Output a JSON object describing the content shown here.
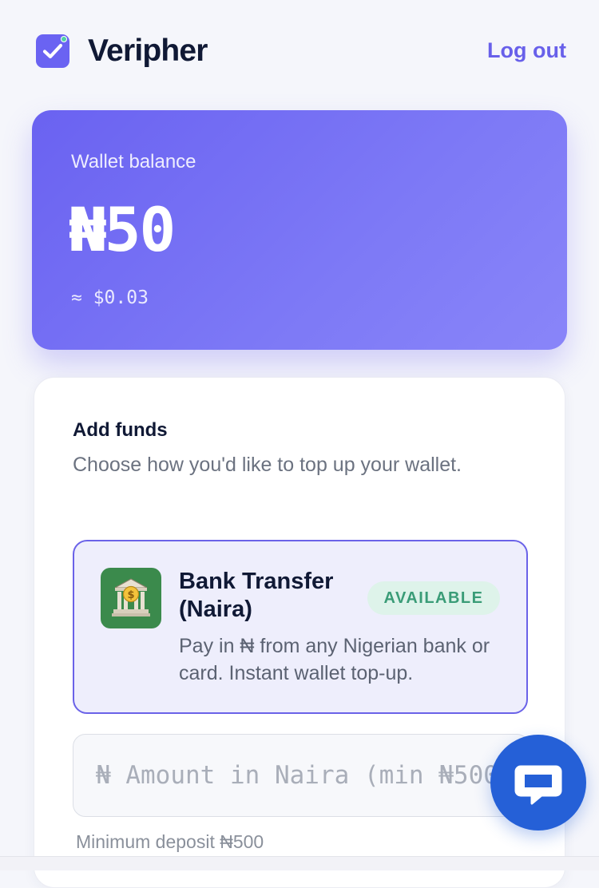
{
  "header": {
    "brand": "Veripher",
    "logout_label": "Log out"
  },
  "wallet": {
    "label": "Wallet balance",
    "amount": "₦50",
    "usd_equiv": "≈ $0.03"
  },
  "add_funds": {
    "title": "Add funds",
    "subtitle": "Choose how you'd like to top up your wallet.",
    "option": {
      "icon": "bank-icon",
      "title": "Bank Transfer (Naira)",
      "badge": "AVAILABLE",
      "description": "Pay in ₦ from any Nigerian bank or card. Instant wallet top-up."
    },
    "amount_input": {
      "placeholder": "₦ Amount in Naira (min ₦500)",
      "value": ""
    },
    "min_note": "Minimum deposit ₦500"
  },
  "chat": {
    "icon": "chat-bubble-icon"
  },
  "colors": {
    "accent": "#6a62f1",
    "badge_text": "#3a9c77",
    "chat": "#2560d7"
  }
}
